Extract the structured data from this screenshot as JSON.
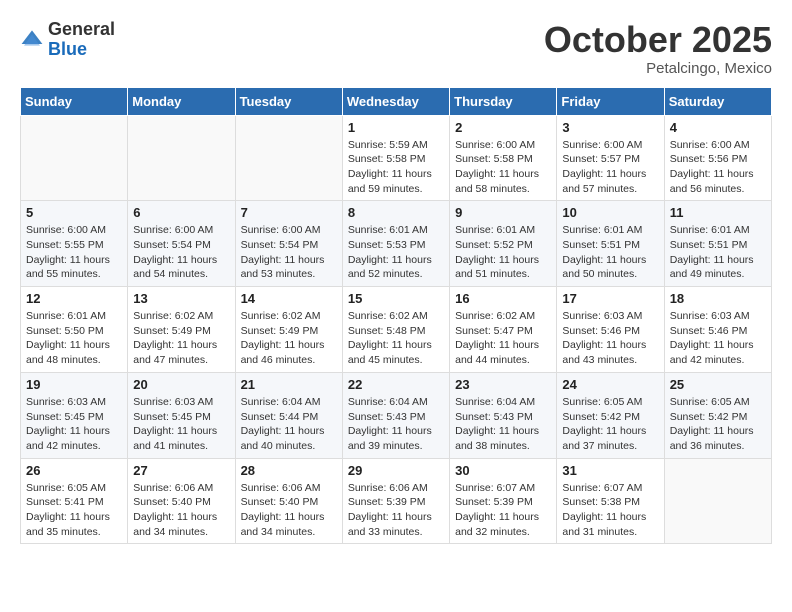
{
  "logo": {
    "general": "General",
    "blue": "Blue"
  },
  "header": {
    "month": "October 2025",
    "location": "Petalcingo, Mexico"
  },
  "weekdays": [
    "Sunday",
    "Monday",
    "Tuesday",
    "Wednesday",
    "Thursday",
    "Friday",
    "Saturday"
  ],
  "weeks": [
    [
      {
        "day": "",
        "info": ""
      },
      {
        "day": "",
        "info": ""
      },
      {
        "day": "",
        "info": ""
      },
      {
        "day": "1",
        "info": "Sunrise: 5:59 AM\nSunset: 5:58 PM\nDaylight: 11 hours\nand 59 minutes."
      },
      {
        "day": "2",
        "info": "Sunrise: 6:00 AM\nSunset: 5:58 PM\nDaylight: 11 hours\nand 58 minutes."
      },
      {
        "day": "3",
        "info": "Sunrise: 6:00 AM\nSunset: 5:57 PM\nDaylight: 11 hours\nand 57 minutes."
      },
      {
        "day": "4",
        "info": "Sunrise: 6:00 AM\nSunset: 5:56 PM\nDaylight: 11 hours\nand 56 minutes."
      }
    ],
    [
      {
        "day": "5",
        "info": "Sunrise: 6:00 AM\nSunset: 5:55 PM\nDaylight: 11 hours\nand 55 minutes."
      },
      {
        "day": "6",
        "info": "Sunrise: 6:00 AM\nSunset: 5:54 PM\nDaylight: 11 hours\nand 54 minutes."
      },
      {
        "day": "7",
        "info": "Sunrise: 6:00 AM\nSunset: 5:54 PM\nDaylight: 11 hours\nand 53 minutes."
      },
      {
        "day": "8",
        "info": "Sunrise: 6:01 AM\nSunset: 5:53 PM\nDaylight: 11 hours\nand 52 minutes."
      },
      {
        "day": "9",
        "info": "Sunrise: 6:01 AM\nSunset: 5:52 PM\nDaylight: 11 hours\nand 51 minutes."
      },
      {
        "day": "10",
        "info": "Sunrise: 6:01 AM\nSunset: 5:51 PM\nDaylight: 11 hours\nand 50 minutes."
      },
      {
        "day": "11",
        "info": "Sunrise: 6:01 AM\nSunset: 5:51 PM\nDaylight: 11 hours\nand 49 minutes."
      }
    ],
    [
      {
        "day": "12",
        "info": "Sunrise: 6:01 AM\nSunset: 5:50 PM\nDaylight: 11 hours\nand 48 minutes."
      },
      {
        "day": "13",
        "info": "Sunrise: 6:02 AM\nSunset: 5:49 PM\nDaylight: 11 hours\nand 47 minutes."
      },
      {
        "day": "14",
        "info": "Sunrise: 6:02 AM\nSunset: 5:49 PM\nDaylight: 11 hours\nand 46 minutes."
      },
      {
        "day": "15",
        "info": "Sunrise: 6:02 AM\nSunset: 5:48 PM\nDaylight: 11 hours\nand 45 minutes."
      },
      {
        "day": "16",
        "info": "Sunrise: 6:02 AM\nSunset: 5:47 PM\nDaylight: 11 hours\nand 44 minutes."
      },
      {
        "day": "17",
        "info": "Sunrise: 6:03 AM\nSunset: 5:46 PM\nDaylight: 11 hours\nand 43 minutes."
      },
      {
        "day": "18",
        "info": "Sunrise: 6:03 AM\nSunset: 5:46 PM\nDaylight: 11 hours\nand 42 minutes."
      }
    ],
    [
      {
        "day": "19",
        "info": "Sunrise: 6:03 AM\nSunset: 5:45 PM\nDaylight: 11 hours\nand 42 minutes."
      },
      {
        "day": "20",
        "info": "Sunrise: 6:03 AM\nSunset: 5:45 PM\nDaylight: 11 hours\nand 41 minutes."
      },
      {
        "day": "21",
        "info": "Sunrise: 6:04 AM\nSunset: 5:44 PM\nDaylight: 11 hours\nand 40 minutes."
      },
      {
        "day": "22",
        "info": "Sunrise: 6:04 AM\nSunset: 5:43 PM\nDaylight: 11 hours\nand 39 minutes."
      },
      {
        "day": "23",
        "info": "Sunrise: 6:04 AM\nSunset: 5:43 PM\nDaylight: 11 hours\nand 38 minutes."
      },
      {
        "day": "24",
        "info": "Sunrise: 6:05 AM\nSunset: 5:42 PM\nDaylight: 11 hours\nand 37 minutes."
      },
      {
        "day": "25",
        "info": "Sunrise: 6:05 AM\nSunset: 5:42 PM\nDaylight: 11 hours\nand 36 minutes."
      }
    ],
    [
      {
        "day": "26",
        "info": "Sunrise: 6:05 AM\nSunset: 5:41 PM\nDaylight: 11 hours\nand 35 minutes."
      },
      {
        "day": "27",
        "info": "Sunrise: 6:06 AM\nSunset: 5:40 PM\nDaylight: 11 hours\nand 34 minutes."
      },
      {
        "day": "28",
        "info": "Sunrise: 6:06 AM\nSunset: 5:40 PM\nDaylight: 11 hours\nand 34 minutes."
      },
      {
        "day": "29",
        "info": "Sunrise: 6:06 AM\nSunset: 5:39 PM\nDaylight: 11 hours\nand 33 minutes."
      },
      {
        "day": "30",
        "info": "Sunrise: 6:07 AM\nSunset: 5:39 PM\nDaylight: 11 hours\nand 32 minutes."
      },
      {
        "day": "31",
        "info": "Sunrise: 6:07 AM\nSunset: 5:38 PM\nDaylight: 11 hours\nand 31 minutes."
      },
      {
        "day": "",
        "info": ""
      }
    ]
  ]
}
